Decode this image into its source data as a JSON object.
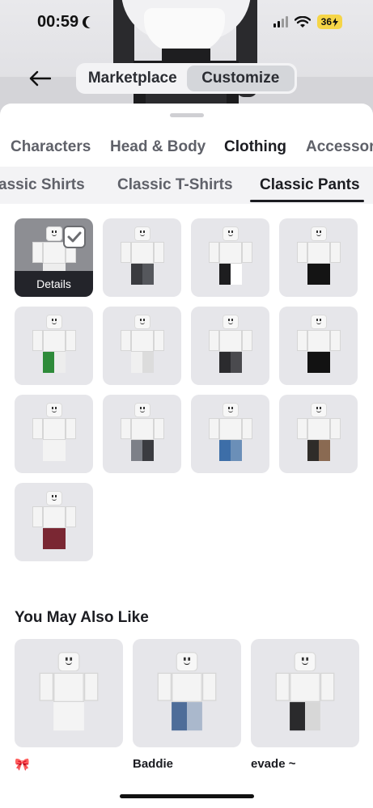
{
  "status_bar": {
    "time": "00:59",
    "battery": "36",
    "moon_icon": "moon-icon",
    "signal_icon": "cellular-signal-icon",
    "wifi_icon": "wifi-icon"
  },
  "header": {
    "back_icon": "arrow-left-icon",
    "mode_tabs": [
      {
        "label": "Marketplace",
        "active": false
      },
      {
        "label": "Customize",
        "active": true
      }
    ]
  },
  "category_tabs": [
    {
      "label": "Characters",
      "active": false
    },
    {
      "label": "Head & Body",
      "active": false
    },
    {
      "label": "Clothing",
      "active": true
    },
    {
      "label": "Accessor",
      "active": false
    }
  ],
  "sub_tabs": [
    {
      "label": "assic Shirts",
      "active": false
    },
    {
      "label": "Classic T-Shirts",
      "active": false
    },
    {
      "label": "Classic Pants",
      "active": true
    }
  ],
  "items": [
    {
      "selected": true,
      "details_label": "Details",
      "legs": [
        "#ededed",
        "#ededed"
      ]
    },
    {
      "legs": [
        "#3a3b3f",
        "#55575c"
      ]
    },
    {
      "legs": [
        "#1d1d1f",
        "#ffffff"
      ]
    },
    {
      "legs": [
        "#141414",
        "#141414"
      ]
    },
    {
      "legs": [
        "#2e8b3a",
        "#ededed"
      ]
    },
    {
      "legs": [
        "#f0f0f0",
        "#dcdcdc"
      ]
    },
    {
      "legs": [
        "#2b2b2e",
        "#4a4a4e"
      ]
    },
    {
      "legs": [
        "#121212",
        "#121212"
      ]
    },
    {
      "legs": [
        "#f3f3f3",
        "#f3f3f3"
      ]
    },
    {
      "legs": [
        "#7d8088",
        "#3a3b40"
      ]
    },
    {
      "legs": [
        "#3d6ea8",
        "#6b8fb8"
      ]
    },
    {
      "legs": [
        "#2f2c29",
        "#8a6a52"
      ]
    },
    {
      "legs": [
        "#7a2733",
        "#7a2733"
      ]
    }
  ],
  "recommended": {
    "title": "You May Also Like",
    "items": [
      {
        "name": "🎀",
        "legs": [
          "#f4f4f4",
          "#f4f4f4"
        ]
      },
      {
        "name": "Baddie",
        "legs": [
          "#4e6d99",
          "#aab8cc"
        ]
      },
      {
        "name": "evade ~",
        "legs": [
          "#2a2a2c",
          "#d7d7d7"
        ]
      }
    ]
  }
}
